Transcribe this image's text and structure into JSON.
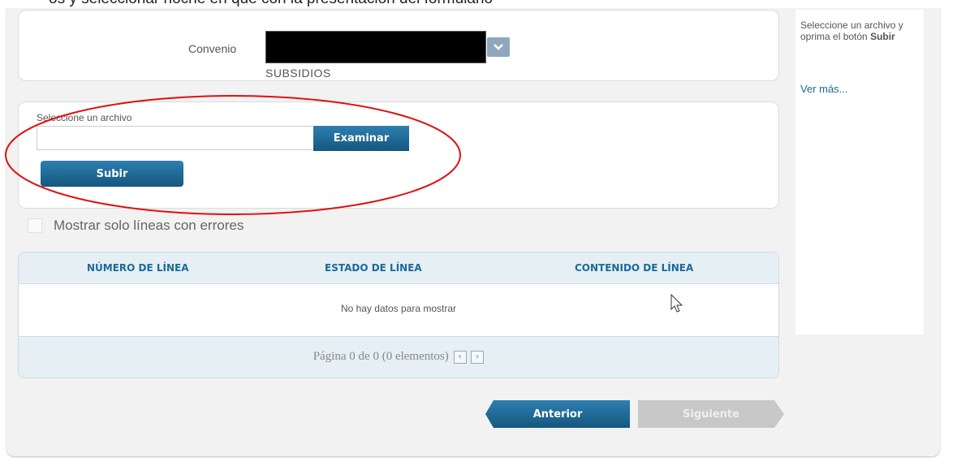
{
  "top_text": "os y seleccionar noche en que con la presentación del formulario",
  "convenio": {
    "label": "Convenio",
    "selected_value": "",
    "subtext": "SUBSIDIOS"
  },
  "upload": {
    "label": "Seleccione un archivo",
    "file_value": "",
    "browse_button": "Examinar",
    "upload_button": "Subir"
  },
  "filter": {
    "checkbox_label": "Mostrar solo líneas con errores",
    "checked": false
  },
  "grid": {
    "columns": [
      "NÚMERO DE LÍNEA",
      "ESTADO DE LÍNEA",
      "CONTENIDO DE LÍNEA"
    ],
    "empty_message": "No hay datos para mostrar",
    "pager_text": "Página 0 de 0 (0 elementos)",
    "prev_icon": "chevron-left-icon",
    "next_icon": "chevron-right-icon"
  },
  "help": {
    "text_before": "Seleccione un archivo y oprima el botón ",
    "text_bold": "Subir",
    "link": "Ver más..."
  },
  "nav": {
    "prev_label": "Anterior",
    "next_label": "Siguiente"
  },
  "colors": {
    "primary": "#15577f",
    "header_bg": "#e6eff4",
    "annotation": "#e01010",
    "disabled": "#c8c8c8"
  }
}
